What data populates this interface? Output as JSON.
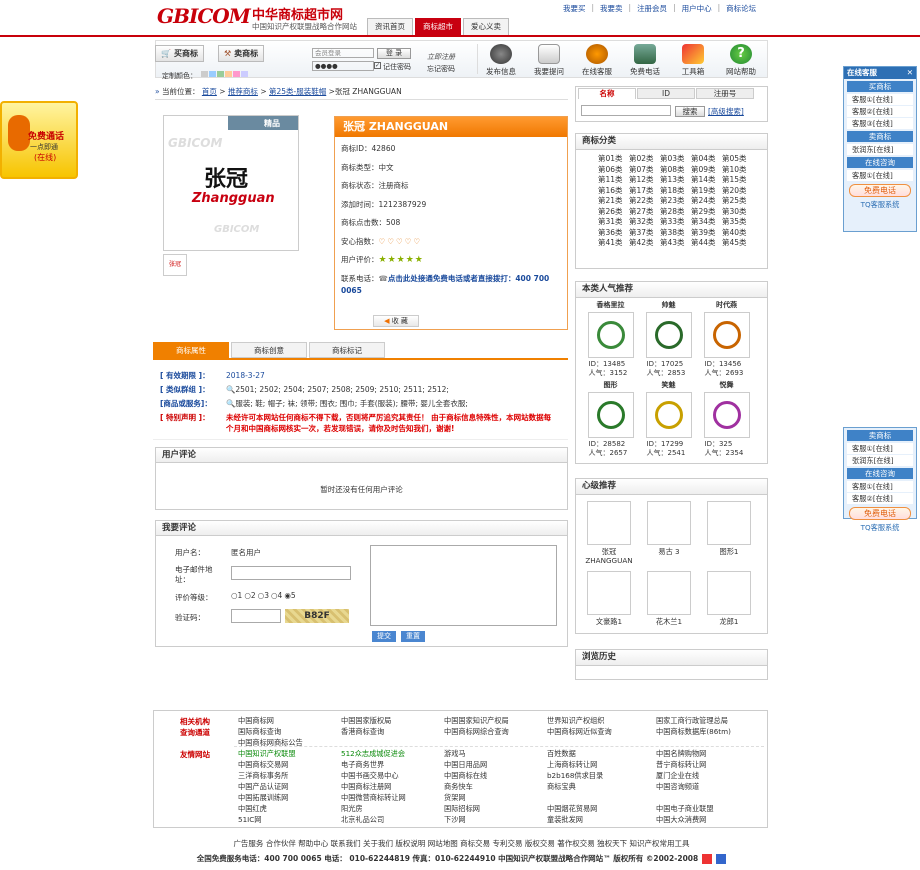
{
  "header": {
    "logo": "GBICOM",
    "site_title": "中华商标超市网",
    "site_subtitle": "中国知识产权联盟战略合作网站",
    "tabs": [
      "资讯首页",
      "商标超市",
      "爱心义卖"
    ],
    "top_links": [
      "我要买",
      "我要卖",
      "注册会员",
      "用户中心",
      "商标论坛"
    ]
  },
  "toolbar": {
    "buy_label": "买商标",
    "sell_label": "卖商标",
    "color_label": "定制颜色：",
    "login_placeholder": "会员登录",
    "password_value": "●●●●",
    "login_button": "登 录",
    "remember_label": "记住密码",
    "forgot_label": "忘记密码",
    "right_link": "立即注册",
    "tools": [
      "发布信息",
      "我要提问",
      "在线客服",
      "免费电话",
      "工具箱",
      "网站帮助"
    ]
  },
  "breadcrumb": {
    "label": "当前位置：",
    "items": [
      "首页",
      "推荐商标",
      "第25类-服装鞋帽"
    ],
    "current": "张冠 ZHANGGUAN"
  },
  "product": {
    "badge": "精品",
    "logo_cn": "张冠",
    "logo_en": "Zhangguan",
    "title": "张冠 ZHANGGUAN",
    "id_label": "商标ID：",
    "id": "42860",
    "type_label": "商标类型：",
    "type": "中文",
    "status_label": "商标状态：",
    "status": "注册商标",
    "added_label": "添加时间：",
    "added": "1212387929",
    "clicks_label": "商标点击数：",
    "clicks": "508",
    "safety_label": "安心指数：",
    "safety_stars": 5,
    "rating_label": "用户评价：",
    "rating_stars": 5,
    "contact_label": "联系电话：",
    "contact_text": "点击此处接通免费电话或者直接拨打：400 700 0065",
    "fav_button": "收 藏"
  },
  "attr_tabs": [
    "商标属性",
    "商标创意",
    "商标标记"
  ],
  "attributes": {
    "valid_key": "[ 有效期限 ]：",
    "valid_val": "2018-3-27",
    "group_key": "[ 类似群组 ]：",
    "group_val": "2501; 2502; 2504; 2507; 2508; 2509; 2510; 2511; 2512;",
    "goods_key": "[商品或服务]：",
    "goods_val": "服装; 鞋; 帽子; 袜; 领带; 围衣; 围巾; 手套(服装); 腰带; 婴儿全套衣服;",
    "notice_key": "[ 特别声明 ]：",
    "notice_val": "未经许可本网站任何商标不得下载，否则将严厉追究其责任！ 由于商标信息特殊性，本网站数据每个月和中国商标网核实一次，若发现错误，请你及时告知我们，谢谢!"
  },
  "reviews": {
    "title": "用户评论",
    "empty": "暂时还没有任何用户评论"
  },
  "review_form": {
    "title": "我要评论",
    "user_label": "用户名：",
    "user_value": "匿名用户",
    "email_label": "电子邮件地址：",
    "level_label": "评价等级：",
    "levels": [
      "1",
      "2",
      "3",
      "4",
      "5"
    ],
    "captcha_label": "验证码：",
    "captcha": "B82F",
    "submit": "提交",
    "reset": "重置"
  },
  "search": {
    "tabs": [
      "名称",
      "ID",
      "注册号"
    ],
    "button": "搜索",
    "advanced": "[高级搜索]"
  },
  "categories": {
    "title": "商标分类",
    "items": [
      "第01类",
      "第02类",
      "第03类",
      "第04类",
      "第05类",
      "第06类",
      "第07类",
      "第08类",
      "第09类",
      "第10类",
      "第11类",
      "第12类",
      "第13类",
      "第14类",
      "第15类",
      "第16类",
      "第17类",
      "第18类",
      "第19类",
      "第20类",
      "第21类",
      "第22类",
      "第23类",
      "第24类",
      "第25类",
      "第26类",
      "第27类",
      "第28类",
      "第29类",
      "第30类",
      "第31类",
      "第32类",
      "第33类",
      "第34类",
      "第35类",
      "第36类",
      "第37类",
      "第38类",
      "第39类",
      "第40类",
      "第41类",
      "第42类",
      "第43类",
      "第44类",
      "第45类"
    ]
  },
  "popular": {
    "title": "本类人气推荐",
    "items": [
      {
        "name": "香格里拉",
        "id": "ID：13485",
        "pop": "人气：3152"
      },
      {
        "name": "帅魅",
        "id": "ID：17025",
        "pop": "人气：2853"
      },
      {
        "name": "时代燕",
        "id": "ID：13456",
        "pop": "人气：2693"
      },
      {
        "name": "图形",
        "id": "ID：28582",
        "pop": "人气：2657"
      },
      {
        "name": "笑魅",
        "id": "ID：17299",
        "pop": "人气：2541"
      },
      {
        "name": "悦舞",
        "id": "ID：325",
        "pop": "人气：2354"
      }
    ]
  },
  "featured": {
    "title": "心级推荐",
    "items": [
      "张冠ZHANGGUAN",
      "易古 3",
      "图形1",
      "文豪路1",
      "花木兰1",
      "龙郎1"
    ]
  },
  "history": {
    "title": "浏览历史"
  },
  "links": {
    "label_related": "相关机构",
    "label_query": "查询通道",
    "label_friends": "友情网站",
    "rows": [
      [
        "中国商标网",
        "中国国家版权局",
        "中国国家知识产权局",
        "世界知识产权组织",
        "国家工商行政管理总局"
      ],
      [
        "国际商标查询",
        "香港商标查询",
        "中国商标网综合查询",
        "中国商标网近似查询",
        "中国商标数据库(86tm)"
      ],
      [
        "中国商标网商标公告",
        "",
        "",
        "",
        ""
      ],
      [
        "中国知识产权联盟",
        "512众志成城促进会",
        "游戏马",
        "百姓数据",
        "中国名牌购物网"
      ],
      [
        "中国商标交易网",
        "电子商务世界",
        "中国日用品网",
        "上海商标转让网",
        "普宁商标转让网"
      ],
      [
        "三洋商标事务所",
        "中国书画交易中心",
        "中国商标在线",
        "b2b168供求目录",
        "厦门企业在线"
      ],
      [
        "中国产品认证网",
        "中国商标注册网",
        "商务快车",
        "商标宝典",
        "中国咨询频道"
      ],
      [
        "中国拓展训练网",
        "中国微营商标转让网",
        "货架网",
        "",
        ""
      ],
      [
        "中国红虎",
        "阳光房",
        "国际招标网",
        "中国烟花贸易网",
        "中国电子商业联盟"
      ],
      [
        "51IC网",
        "北京礼品公司",
        "下沙网",
        "童装批发网",
        "中国大众消费网"
      ]
    ]
  },
  "footer": {
    "links": "广告服务 合作伙伴 帮助中心 联系我们 关于我们 版权说明 网站地图 商标交易 专利交易 版权交易 著作权交易 独权天下 知识产权常用工具",
    "contact": "全国免费服务电话：400 700 0065 电话： 010-62244819 传真：010-62244910 中国知识产权联盟战略合作网站™ 版权所有 ©2002-2008"
  },
  "side_service": {
    "title": "在线客服",
    "buy": "买商标",
    "sell": "卖商标",
    "consult": "在线咨询",
    "agents_buy": [
      "客服①[在线]",
      "客服②[在线]",
      "客服③[在线]"
    ],
    "agents_sell": [
      "张润东[在线]"
    ],
    "agents_consult": [
      "客服①[在线]"
    ],
    "call": "免费电话",
    "footer": "TQ客服系统"
  },
  "side_service2": {
    "sell": "卖商标",
    "consult": "在线咨询",
    "agents_sell": [
      "客服①[在线]",
      "张润东[在线]"
    ],
    "agents_consult": [
      "客服①[在线]",
      "客服②[在线]"
    ],
    "call": "免费电话",
    "footer": "TQ客服系统"
  },
  "call_widget": {
    "title": "免费通话",
    "line2": "一点即通",
    "line3": "(在线)"
  }
}
